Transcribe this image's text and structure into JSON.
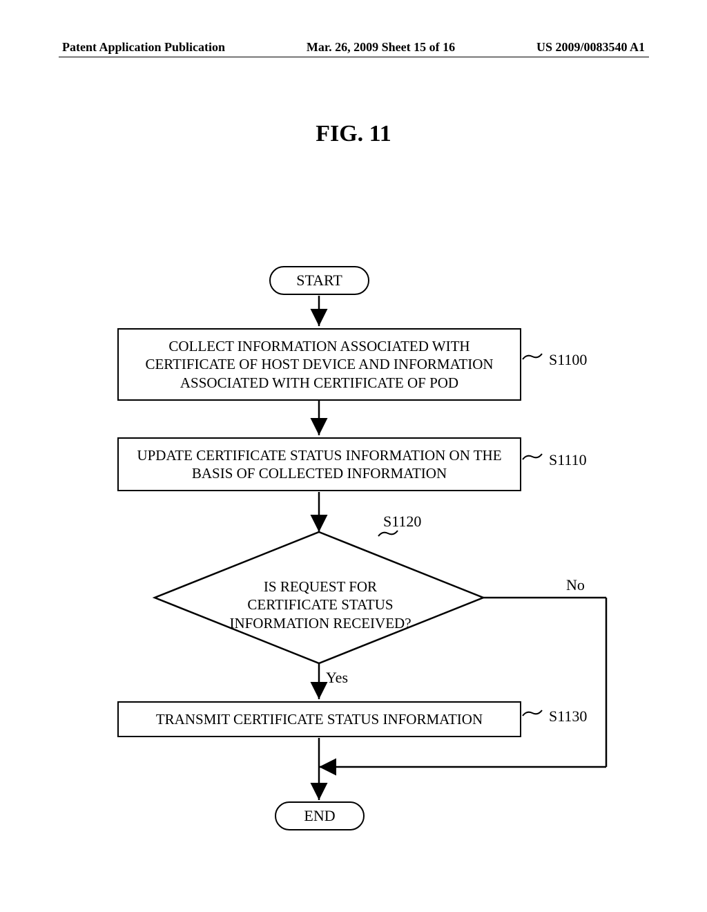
{
  "header": {
    "left": "Patent Application Publication",
    "center": "Mar. 26, 2009  Sheet 15 of 16",
    "right": "US 2009/0083540 A1"
  },
  "figure_title": "FIG. 11",
  "nodes": {
    "start": "START",
    "s1100": "COLLECT INFORMATION ASSOCIATED WITH CERTIFICATE OF HOST DEVICE AND INFORMATION ASSOCIATED WITH CERTIFICATE OF POD",
    "s1110": "UPDATE CERTIFICATE STATUS INFORMATION ON THE BASIS OF COLLECTED INFORMATION",
    "s1120": "IS REQUEST FOR CERTIFICATE STATUS INFORMATION RECEIVED?",
    "s1130": "TRANSMIT CERTIFICATE STATUS INFORMATION",
    "end": "END"
  },
  "step_labels": {
    "s1100": "S1100",
    "s1110": "S1110",
    "s1120": "S1120",
    "s1130": "S1130"
  },
  "branch_labels": {
    "yes": "Yes",
    "no": "No"
  },
  "chart_data": {
    "type": "flowchart",
    "title": "FIG. 11",
    "nodes": [
      {
        "id": "start",
        "type": "terminal",
        "label": "START"
      },
      {
        "id": "s1100",
        "type": "process",
        "label": "COLLECT INFORMATION ASSOCIATED WITH CERTIFICATE OF HOST DEVICE AND INFORMATION ASSOCIATED WITH CERTIFICATE OF POD",
        "step": "S1100"
      },
      {
        "id": "s1110",
        "type": "process",
        "label": "UPDATE CERTIFICATE STATUS INFORMATION ON THE BASIS OF COLLECTED INFORMATION",
        "step": "S1110"
      },
      {
        "id": "s1120",
        "type": "decision",
        "label": "IS REQUEST FOR CERTIFICATE STATUS INFORMATION RECEIVED?",
        "step": "S1120"
      },
      {
        "id": "s1130",
        "type": "process",
        "label": "TRANSMIT CERTIFICATE STATUS INFORMATION",
        "step": "S1130"
      },
      {
        "id": "end",
        "type": "terminal",
        "label": "END"
      }
    ],
    "edges": [
      {
        "from": "start",
        "to": "s1100"
      },
      {
        "from": "s1100",
        "to": "s1110"
      },
      {
        "from": "s1110",
        "to": "s1120"
      },
      {
        "from": "s1120",
        "to": "s1130",
        "label": "Yes"
      },
      {
        "from": "s1120",
        "to": "end",
        "label": "No"
      },
      {
        "from": "s1130",
        "to": "end"
      }
    ]
  }
}
